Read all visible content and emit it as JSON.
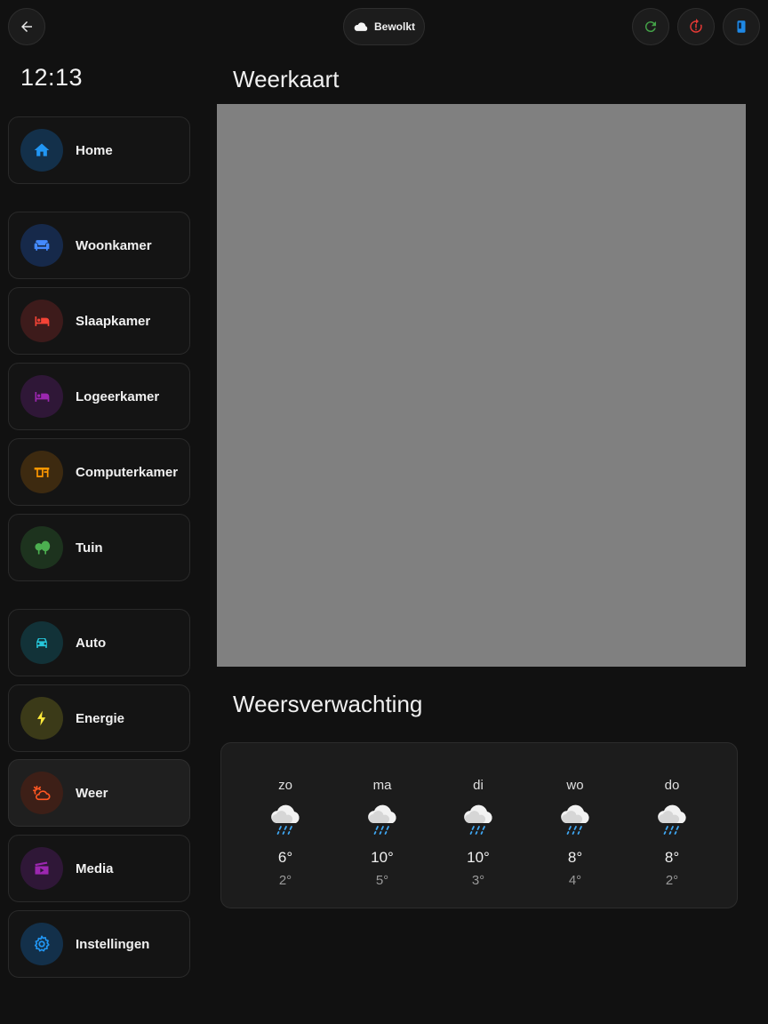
{
  "topbar": {
    "weather_chip": {
      "icon": "cloud-icon",
      "label": "Bewolkt"
    },
    "buttons": {
      "back": {
        "icon": "arrow-left-icon"
      },
      "refresh": {
        "icon": "refresh-icon",
        "color": "#43a047"
      },
      "restart": {
        "icon": "restart-alert-icon",
        "color": "#e53935"
      },
      "tablet": {
        "icon": "tablet-icon",
        "color": "#1e88e5"
      }
    }
  },
  "clock": "12:13",
  "sidebar": {
    "items": [
      {
        "label": "Home",
        "icon": "home-icon",
        "color": "#2196f3",
        "bg": "#13304a"
      },
      {
        "label": "Woonkamer",
        "icon": "sofa-icon",
        "color": "#448aff",
        "bg": "#16294a"
      },
      {
        "label": "Slaapkamer",
        "icon": "bed-icon",
        "color": "#f44336",
        "bg": "#3d1b1b"
      },
      {
        "label": "Logeerkamer",
        "icon": "bed-icon",
        "color": "#9c27b0",
        "bg": "#2f1737"
      },
      {
        "label": "Computerkamer",
        "icon": "desk-icon",
        "color": "#ff9800",
        "bg": "#3d2a10"
      },
      {
        "label": "Tuin",
        "icon": "trees-icon",
        "color": "#4caf50",
        "bg": "#1d331e"
      },
      {
        "label": "Auto",
        "icon": "car-icon",
        "color": "#26c6da",
        "bg": "#123238"
      },
      {
        "label": "Energie",
        "icon": "lightning-icon",
        "color": "#ffeb3b",
        "bg": "#3b3a18"
      },
      {
        "label": "Weer",
        "icon": "weather-partly-cloudy-icon",
        "color": "#ff5722",
        "bg": "#3d1f17"
      },
      {
        "label": "Media",
        "icon": "movie-icon",
        "color": "#9c27b0",
        "bg": "#2f1737"
      },
      {
        "label": "Instellingen",
        "icon": "gear-icon",
        "color": "#2196f3",
        "bg": "#13304a"
      }
    ]
  },
  "main": {
    "map_title": "Weerkaart",
    "forecast_title": "Weersverwachting",
    "forecast": [
      {
        "day": "zo",
        "high": "6°",
        "low": "2°",
        "icon": "rain-cloud-icon"
      },
      {
        "day": "ma",
        "high": "10°",
        "low": "5°",
        "icon": "rain-cloud-icon"
      },
      {
        "day": "di",
        "high": "10°",
        "low": "3°",
        "icon": "rain-cloud-icon"
      },
      {
        "day": "wo",
        "high": "8°",
        "low": "4°",
        "icon": "rain-cloud-icon"
      },
      {
        "day": "do",
        "high": "8°",
        "low": "2°",
        "icon": "rain-cloud-icon"
      }
    ]
  }
}
